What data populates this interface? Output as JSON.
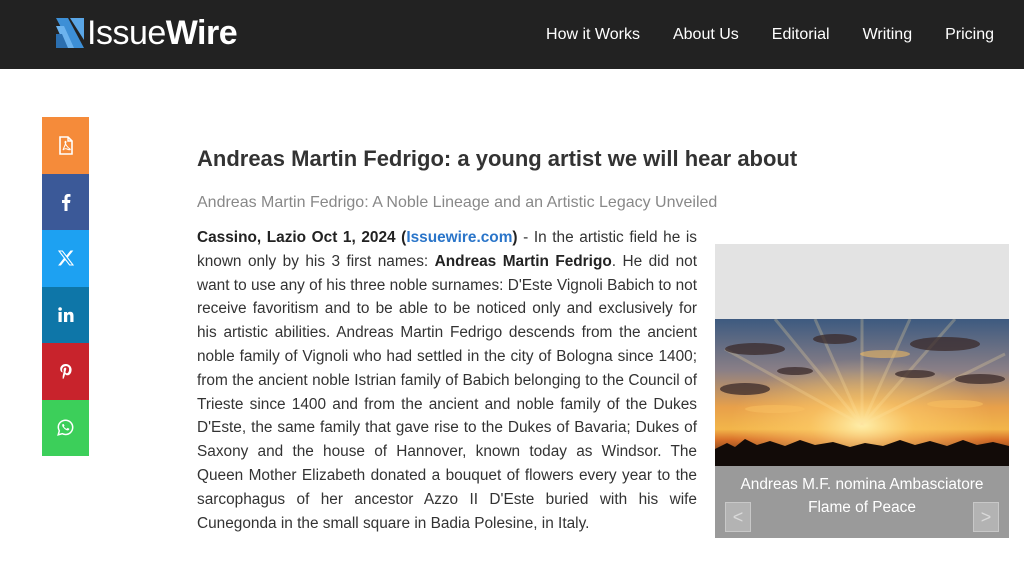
{
  "header": {
    "logo_plain": "Issue",
    "logo_bold": "Wire",
    "nav": [
      {
        "label": "How it Works"
      },
      {
        "label": "About Us"
      },
      {
        "label": "Editorial"
      },
      {
        "label": "Writing"
      },
      {
        "label": "Pricing"
      }
    ]
  },
  "share": {
    "buttons": [
      {
        "icon": "pdf-icon",
        "color": "#f58b3a"
      },
      {
        "icon": "facebook-icon",
        "color": "#3b5998"
      },
      {
        "icon": "x-icon",
        "color": "#1da1f2"
      },
      {
        "icon": "linkedin-icon",
        "color": "#0e76a8"
      },
      {
        "icon": "pinterest-icon",
        "color": "#c8232c"
      },
      {
        "icon": "whatsapp-icon",
        "color": "#3ccf5a"
      }
    ]
  },
  "article": {
    "title": "Andreas Martin Fedrigo: a young artist we will hear about",
    "subtitle": "Andreas Martin Fedrigo: A Noble Lineage and an Artistic Legacy Unveiled",
    "dateline": "Cassino, Lazio Oct 1, 2024 (",
    "source_link": "Issuewire.com",
    "dateline_close": ")",
    "intro": " - In the artistic field he is known only by his 3 first names: ",
    "name": "Andreas Martin Fedrigo",
    "body": ". He did not want to use any of his three noble surnames: D'Este Vignoli Babich to not receive favoritism and to be able to be noticed only and exclusively for his artistic abilities. Andreas Martin Fedrigo descends from the ancient noble family of Vignoli who had settled in the city of Bologna since 1400; from the ancient noble Istrian family of Babich belonging to the Council of Trieste since 1400 and from the ancient and noble family of the Dukes D'Este, the same family that gave rise to the Dukes of Bavaria; Dukes of Saxony and the house of Hannover, known today as Windsor. The Queen Mother Elizabeth donated a bouquet of flowers every year to the sarcophagus of her ancestor Azzo II D'Este buried with his wife Cunegonda in the small square in Badia Polesine, in Italy."
  },
  "slider": {
    "caption_line1": "Andreas M.F. nomina Ambasciatore",
    "caption_line2": "Flame of Peace",
    "prev": "<",
    "next": ">"
  },
  "colors": {
    "header_bg": "#222222",
    "link": "#2a75c9",
    "logo_blue": "#3d8fd6"
  }
}
